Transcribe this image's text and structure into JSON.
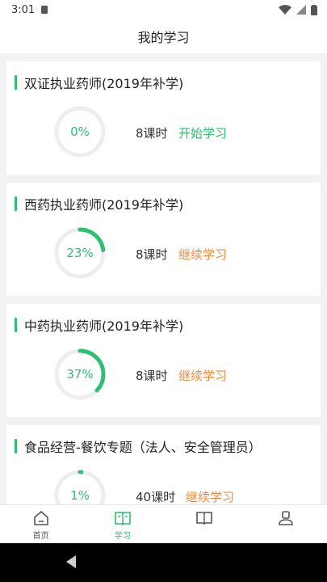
{
  "status_bar": {
    "time": "3:01"
  },
  "header": {
    "title": "我的学习"
  },
  "courses": [
    {
      "title": "双证执业药师(2019年补学)",
      "progress": 0,
      "progress_label": "0%",
      "hours": "8课时",
      "action": "开始学习",
      "action_type": "start"
    },
    {
      "title": "西药执业药师(2019年补学)",
      "progress": 23,
      "progress_label": "23%",
      "hours": "8课时",
      "action": "继续学习",
      "action_type": "continue"
    },
    {
      "title": "中药执业药师(2019年补学)",
      "progress": 37,
      "progress_label": "37%",
      "hours": "8课时",
      "action": "继续学习",
      "action_type": "continue"
    },
    {
      "title": "食品经营-餐饮专题（法人、安全管理员）",
      "progress": 1,
      "progress_label": "1%",
      "hours": "40课时",
      "action": "继续学习",
      "action_type": "continue"
    }
  ],
  "tabs": [
    {
      "label": "首页",
      "icon": "home-icon"
    },
    {
      "label": "学习",
      "icon": "book-open-icon",
      "active": true
    },
    {
      "label": "",
      "icon": "library-icon"
    },
    {
      "label": "",
      "icon": "user-icon"
    }
  ],
  "colors": {
    "accent_green": "#2fbf6f",
    "continue_orange": "#f08a3c",
    "ring_track": "#eeeeee"
  }
}
